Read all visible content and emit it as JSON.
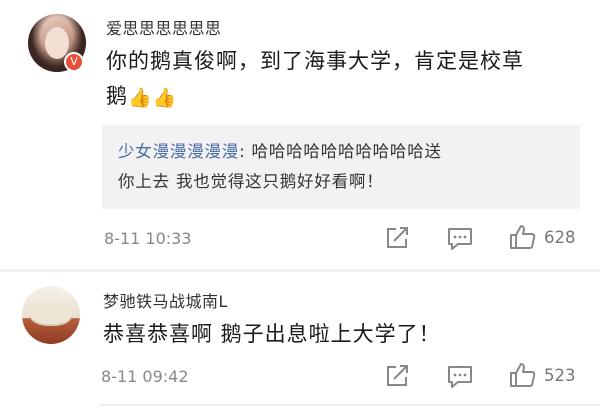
{
  "comments": [
    {
      "username": "爱思思思思思思",
      "content_line1": "你的鹅真俊啊，到了海事大学，肯定是校草",
      "content_line2": "鹅",
      "emoji": "👍👍",
      "badge": "V",
      "quote": {
        "user": "少女漫漫漫漫漫",
        "separator": ": ",
        "text_line1": "哈哈哈哈哈哈哈哈哈哈送",
        "text_line2": "你上去 我也觉得这只鹅好好看啊！"
      },
      "time": "8-11 10:33",
      "likes": "628"
    },
    {
      "username": "梦驰铁马战城南L",
      "content": "恭喜恭喜啊 鹅子出息啦上大学了！",
      "time": "8-11 09:42",
      "likes": "523"
    }
  ],
  "icons": {
    "share": "share-icon",
    "reply": "comment-icon",
    "like": "thumbs-up-icon"
  },
  "colors": {
    "username": "#333333",
    "link": "#4a6da7",
    "meta": "#888888",
    "quote_bg": "#f2f2f2"
  }
}
